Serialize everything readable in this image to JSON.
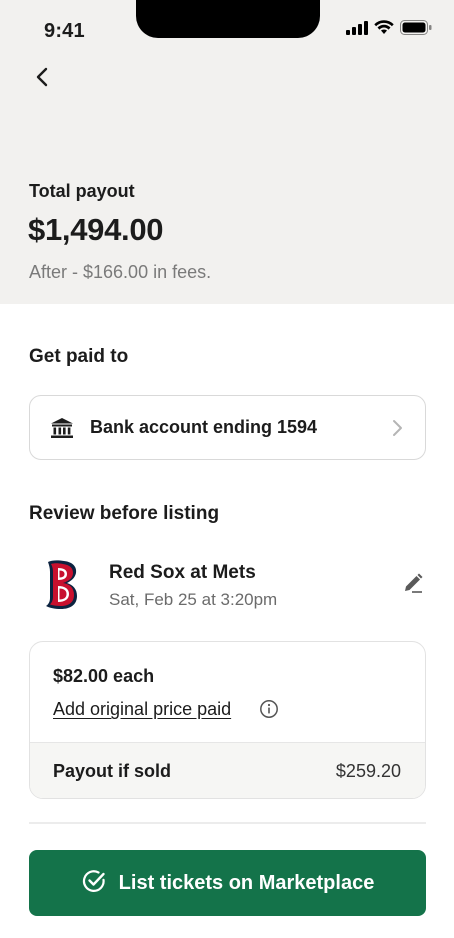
{
  "status_bar": {
    "time": "9:41"
  },
  "header": {
    "back_icon": "chevron-left-icon"
  },
  "payout": {
    "label": "Total payout",
    "amount": "$1,494.00",
    "fees_text": "After - $166.00 in fees."
  },
  "get_paid": {
    "title": "Get paid to",
    "bank_icon": "bank-icon",
    "bank_label": "Bank account ending 1594"
  },
  "review": {
    "title": "Review before listing",
    "event_name": "Red Sox at Mets",
    "event_date": "Sat, Feb 25 at 3:20pm",
    "price_each": "$82.00 each",
    "original_price_link": "Add original price paid",
    "payout_label": "Payout if sold",
    "payout_value": "$259.20"
  },
  "cta": {
    "label": "List tickets on Marketplace",
    "icon": "check-circle-icon"
  },
  "colors": {
    "accent_green": "#14734a",
    "header_bg": "#f2f1ef",
    "logo_red": "#c8102e",
    "logo_navy": "#0c2340"
  }
}
